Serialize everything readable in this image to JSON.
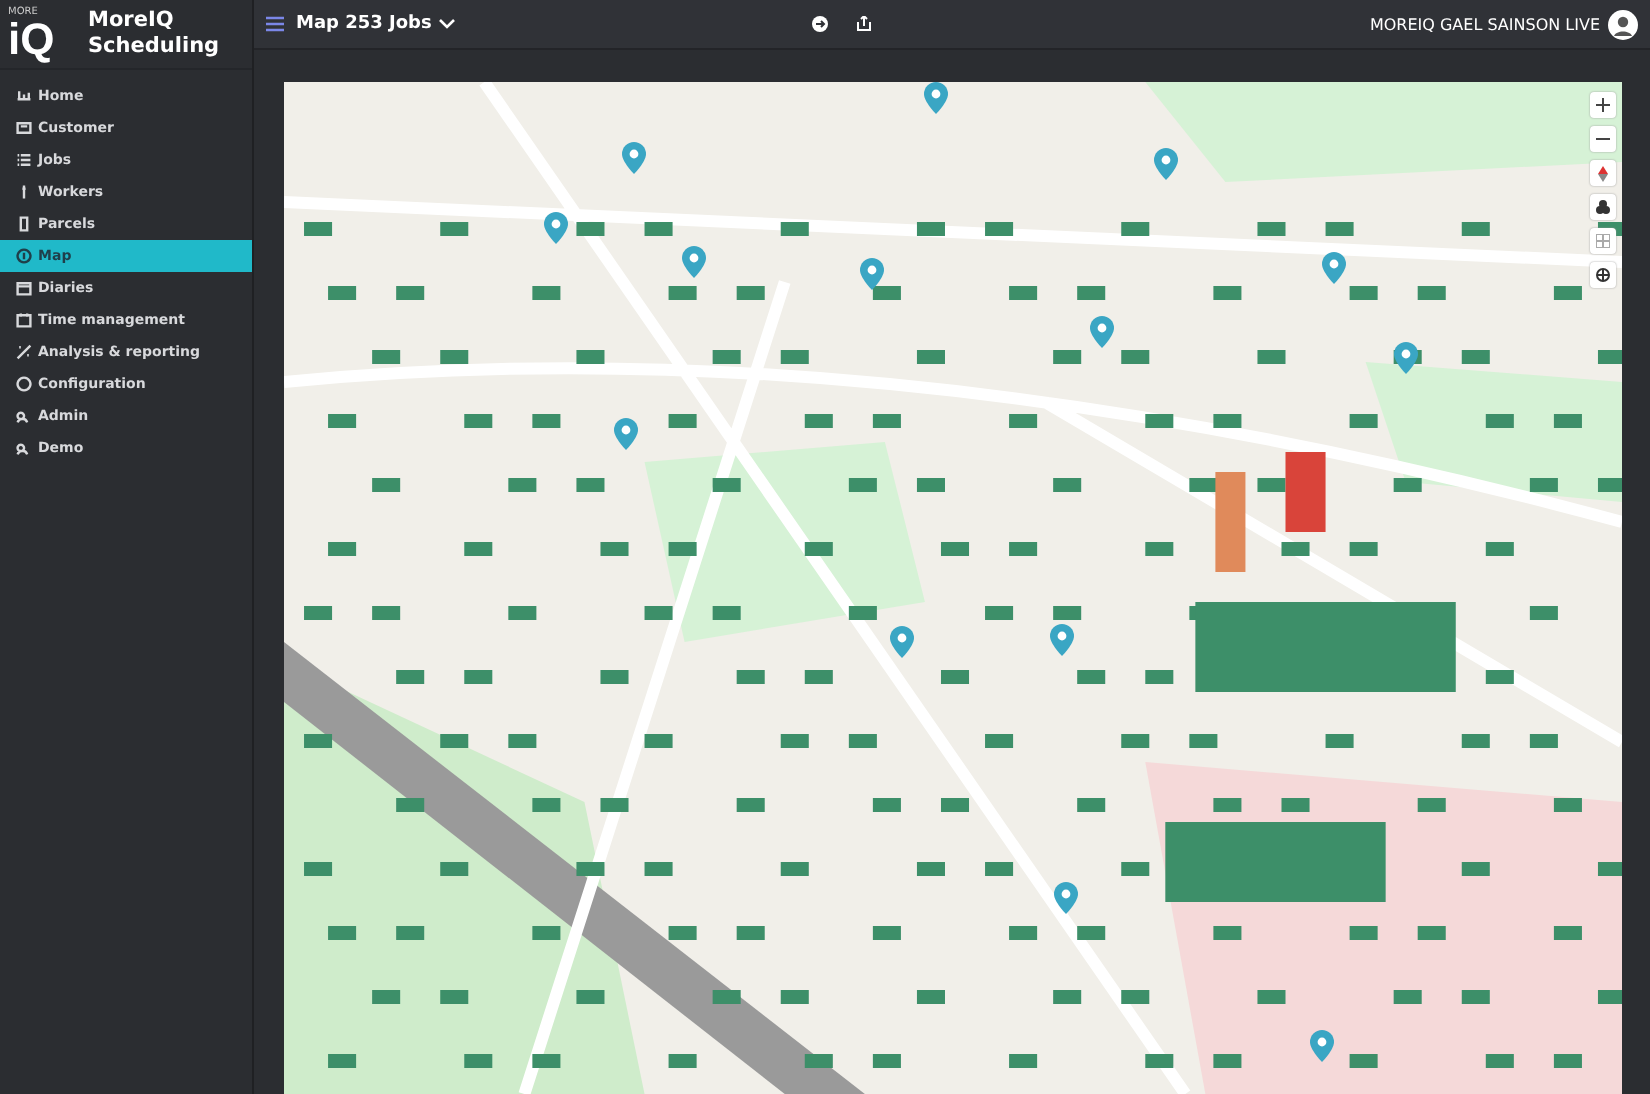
{
  "logo": {
    "small": "MORE",
    "big": "iQ"
  },
  "app_name": "MoreIQ Scheduling",
  "sidebar": {
    "items": [
      {
        "label": "Home",
        "selected": false
      },
      {
        "label": "Customer",
        "selected": false
      },
      {
        "label": "Jobs",
        "selected": false
      },
      {
        "label": "Workers",
        "selected": false
      },
      {
        "label": "Parcels",
        "selected": false
      },
      {
        "label": "Map",
        "selected": true
      },
      {
        "label": "Diaries",
        "selected": false
      },
      {
        "label": "Time management",
        "selected": false
      },
      {
        "label": "Analysis & reporting",
        "selected": false
      },
      {
        "label": "Configuration",
        "selected": false
      },
      {
        "label": "Admin",
        "selected": false
      },
      {
        "label": "Demo",
        "selected": false
      }
    ]
  },
  "top_bar": {
    "title": "Map 253 Jobs",
    "user": "MOREIQ GAEL SAINSON LIVE"
  }
}
